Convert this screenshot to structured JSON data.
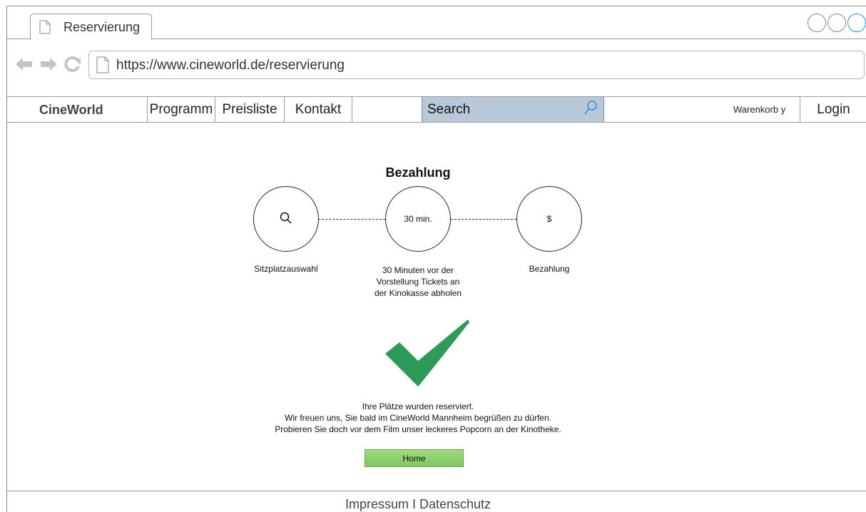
{
  "browser": {
    "tab_title": "Reservierung",
    "url": "https://www.cineworld.de/reservierung"
  },
  "nav": {
    "brand": "CineWorld",
    "items": [
      "Programm",
      "Preisliste",
      "Kontakt"
    ],
    "search_placeholder": "Search",
    "cart": "Warenkorb y",
    "login": "Login"
  },
  "page": {
    "title": "Bezahlung",
    "steps": [
      {
        "icon": "search-icon",
        "circle_text": "",
        "label": "Sitzplatzauswahl"
      },
      {
        "icon": "",
        "circle_text": "30 min.",
        "label_lines": [
          "30 Minuten vor der",
          "Vorstellung Tickets an",
          "der Kinokasse abholen"
        ]
      },
      {
        "icon": "",
        "circle_text": "$",
        "label": "Bezahlung"
      }
    ],
    "message_lines": [
      "Ihre Plätze wurden reserviert.",
      "Wir freuen uns, Sie bald im CineWorld Mannheim begrüßen zu dürfen.",
      "Probieren Sie doch vor dem Film unser leckeres Popcorn an der Kinotheke."
    ],
    "home_button": "Home"
  },
  "footer": {
    "text": "Impressum I Datenschutz"
  },
  "colors": {
    "search_bg": "#b8c8d8",
    "checkmark": "#2e9a5a",
    "home_button": "#8fd06e",
    "active_window_circle": "#2d8fe0"
  }
}
